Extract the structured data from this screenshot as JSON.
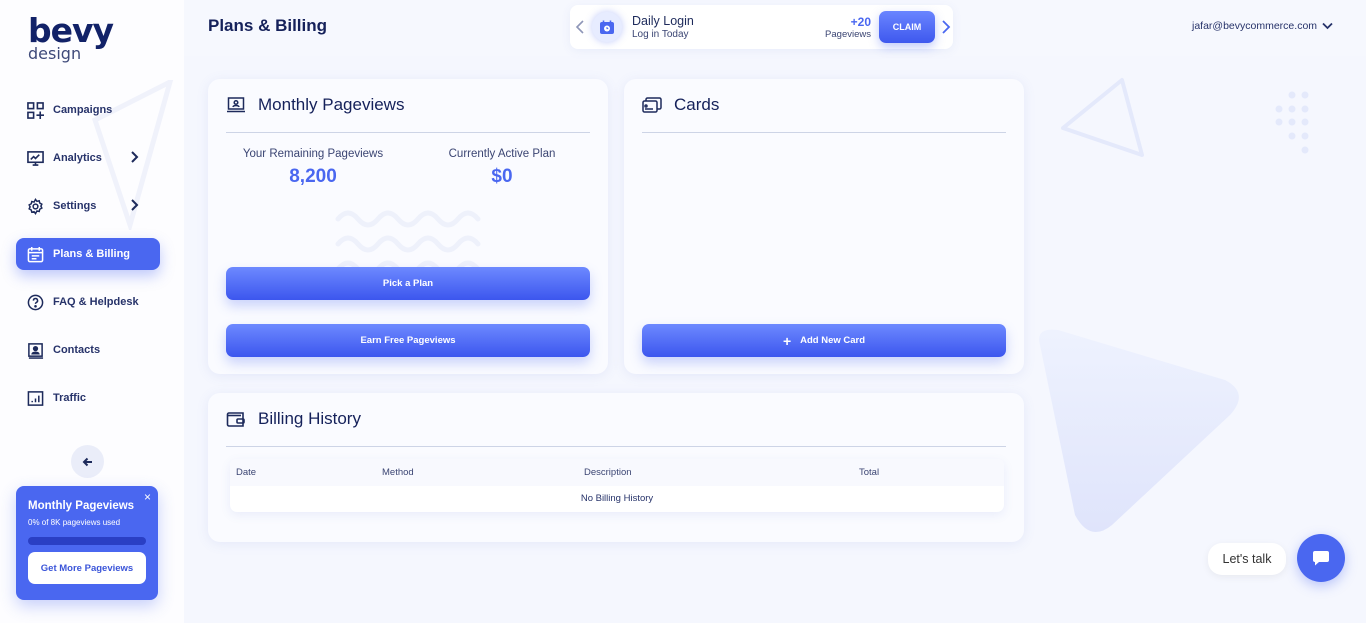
{
  "brand": {
    "name": "bevy",
    "sub": "design"
  },
  "sidebar": {
    "items": [
      {
        "label": "Campaigns",
        "icon": "grid-plus-icon",
        "has_submenu": false,
        "active": false
      },
      {
        "label": "Analytics",
        "icon": "monitor-chart-icon",
        "has_submenu": true,
        "active": false
      },
      {
        "label": "Settings",
        "icon": "gear-icon",
        "has_submenu": true,
        "active": false
      },
      {
        "label": "Plans & Billing",
        "icon": "calendar-icon",
        "has_submenu": false,
        "active": true
      },
      {
        "label": "FAQ & Helpdesk",
        "icon": "question-circle-icon",
        "has_submenu": false,
        "active": false
      },
      {
        "label": "Contacts",
        "icon": "contact-book-icon",
        "has_submenu": false,
        "active": false
      },
      {
        "label": "Traffic",
        "icon": "bar-chart-icon",
        "has_submenu": false,
        "active": false
      }
    ],
    "collapse_icon": "arrow-left-icon",
    "promo": {
      "title": "Monthly Pageviews",
      "subtitle": "0% of 8K pageviews used",
      "usage_percent": 0,
      "button": "Get More Pageviews",
      "close": "×"
    }
  },
  "header": {
    "title": "Plans & Billing",
    "daily": {
      "title": "Daily Login",
      "subtitle": "Log in Today",
      "points": "+20",
      "points_label": "Pageviews",
      "claim": "CLAIM"
    },
    "user_email": "jafar@bevycommerce.com"
  },
  "pageviews_card": {
    "title": "Monthly Pageviews",
    "remaining_label": "Your Remaining Pageviews",
    "remaining_value": "8,200",
    "plan_label": "Currently Active Plan",
    "plan_value": "$0",
    "pick_plan": "Pick a Plan",
    "earn_free": "Earn Free Pageviews"
  },
  "cards_card": {
    "title": "Cards",
    "add_icon": "+",
    "add_button": "Add New Card"
  },
  "billing": {
    "title": "Billing History",
    "columns": [
      "Date",
      "Method",
      "Description",
      "Total"
    ],
    "empty": "No Billing History"
  },
  "chat": {
    "label": "Let's talk"
  },
  "colors": {
    "accent": "#4a67f0",
    "navy": "#15215a",
    "background": "#f6f8fe"
  }
}
